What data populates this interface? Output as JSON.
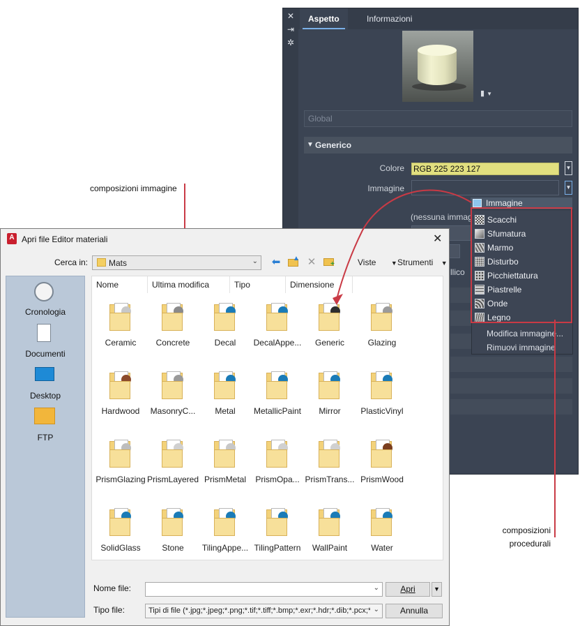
{
  "material_editor": {
    "tabs": [
      "Aspetto",
      "Informazioni"
    ],
    "side_icons": [
      "close-icon",
      "pin-icon",
      "settings-icon"
    ],
    "global_placeholder": "Global",
    "section_title": "Generico",
    "colore_label": "Colore",
    "colore_value": "RGB 225 223 127",
    "colore_swatch": "#e1df7f",
    "immagine_label": "Immagine",
    "none_label": "(nessuna immag",
    "obscured_fragment": "llico"
  },
  "image_menu": {
    "header": "Immagine",
    "procedural_items": [
      "Scacchi",
      "Sfumatura",
      "Marmo",
      "Disturbo",
      "Picchiettatura",
      "Piastrelle",
      "Onde",
      "Legno"
    ],
    "extra_items": [
      "Modifica immagine...",
      "Rimuovi immagine"
    ]
  },
  "annotations": {
    "image_compositions": "composizioni immagine",
    "procedural_line1": "composizioni",
    "procedural_line2": "procedurali",
    "accent_color": "#c93a45"
  },
  "dialog": {
    "title": "Apri file Editor materiali",
    "look_in_label": "Cerca in:",
    "look_in_value": "Mats",
    "views_label": "Viste",
    "tools_label": "Strumenti",
    "places": [
      "Cronologia",
      "Documenti",
      "Desktop",
      "FTP"
    ],
    "columns": [
      "Nome",
      "Ultima modifica",
      "Tipo",
      "Dimensione"
    ],
    "files": [
      "Ceramic",
      "Concrete",
      "Decal",
      "DecalAppe...",
      "Generic",
      "Glazing",
      "Hardwood",
      "MasonryC...",
      "Metal",
      "MetallicPaint",
      "Mirror",
      "PlasticVinyl",
      "PrismGlazing",
      "PrismLayered",
      "PrismMetal",
      "PrismOpa...",
      "PrismTrans...",
      "PrismWood",
      "SolidGlass",
      "Stone",
      "TilingAppe...",
      "TilingPattern",
      "WallPaint",
      "Water"
    ],
    "file_name_label": "Nome file:",
    "file_name_value": "",
    "file_type_label": "Tipo file:",
    "file_type_value": "Tipi di file  (*.jpg;*.jpeg;*.png;*.tif;*.tiff;*.bmp;*.exr;*.hdr;*.dib;*.pcx;*.g",
    "open_button": "Apri",
    "cancel_button": "Annulla"
  }
}
